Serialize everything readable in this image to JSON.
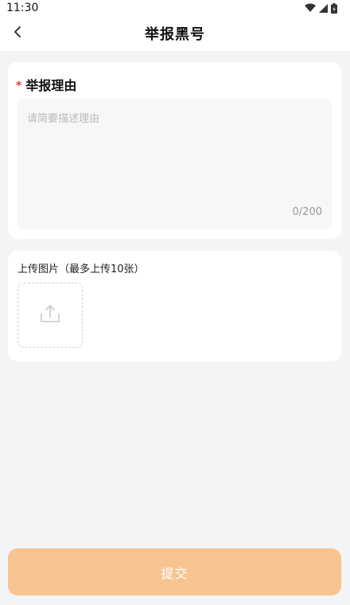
{
  "status_bar": {
    "time": "11:30",
    "icons": [
      "wifi-icon",
      "signal-icon",
      "battery-icon"
    ]
  },
  "nav": {
    "title": "举报黑号",
    "back_icon": "chevron-left-icon"
  },
  "reason": {
    "required_mark": "*",
    "label": "举报理由",
    "placeholder": "请简要描述理由",
    "value": "",
    "counter": "0/200"
  },
  "upload": {
    "label": "上传图片（最多上传10张）",
    "icon": "upload-icon"
  },
  "submit": {
    "label": "提交"
  },
  "colors": {
    "page_background": "#f3f4f6",
    "card_background": "#ffffff",
    "submit_background": "#f7c48f",
    "required_mark": "#e53935",
    "placeholder": "#b9b9b9"
  }
}
